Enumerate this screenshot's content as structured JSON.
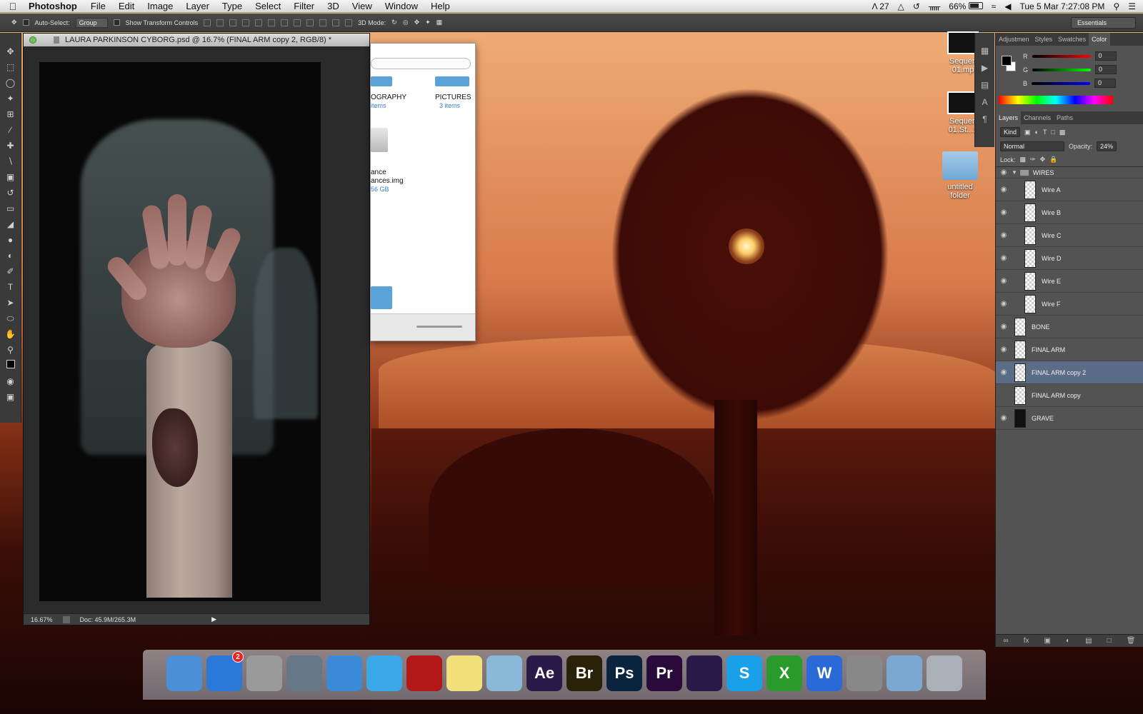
{
  "menubar": {
    "apple_icon": "apple-icon",
    "app_name": "Photoshop",
    "menus": [
      "File",
      "Edit",
      "Image",
      "Layer",
      "Type",
      "Select",
      "Filter",
      "3D",
      "View",
      "Window",
      "Help"
    ],
    "status": {
      "adobe_count": "27",
      "battery": "66%",
      "datetime": "Tue 5 Mar  7:27:08 PM"
    }
  },
  "options_bar": {
    "auto_select_label": "Auto-Select:",
    "auto_select_value": "Group",
    "transform_label": "Show Transform Controls",
    "mode_3d_label": "3D Mode:",
    "workspace": "Essentials"
  },
  "document": {
    "title": "LAURA PARKINSON CYBORG.psd @ 16.7% (FINAL ARM copy 2, RGB/8) *",
    "zoom": "16.67%",
    "doc_size": "Doc: 45.9M/265.3M"
  },
  "finder": {
    "col1_label": "OGRAPHY",
    "col1_sub": "items",
    "col2_label": "PICTURES",
    "col2_sub": "3 items",
    "file_name_line1": "ance",
    "file_name_line2": "ances.img",
    "file_size": "56 GB"
  },
  "desktop": {
    "items": [
      {
        "label": "Sequen 01.mp"
      },
      {
        "label": "Sequen 01.St...1"
      },
      {
        "label": "untitled folder"
      }
    ]
  },
  "color_panel": {
    "tabs": [
      "Adjustmen",
      "Styles",
      "Swatches",
      "Color"
    ],
    "active_tab": "Color",
    "r_label": "R",
    "r_value": "0",
    "g_label": "G",
    "g_value": "0",
    "b_label": "B",
    "b_value": "0"
  },
  "layers_panel": {
    "tabs": [
      "Layers",
      "Channels",
      "Paths"
    ],
    "active_tab": "Layers",
    "kind": "Kind",
    "blend_mode": "Normal",
    "opacity_label": "Opacity:",
    "opacity_value": "24%",
    "lock_label": "Lock:",
    "layers": [
      {
        "name": "WIRES",
        "type": "group",
        "visible": true
      },
      {
        "name": "Wire A",
        "type": "layer",
        "visible": true
      },
      {
        "name": "Wire B",
        "type": "layer",
        "visible": true
      },
      {
        "name": "Wire C",
        "type": "layer",
        "visible": true
      },
      {
        "name": "Wire D",
        "type": "layer",
        "visible": true
      },
      {
        "name": "Wire E",
        "type": "layer",
        "visible": true
      },
      {
        "name": "Wire F",
        "type": "layer",
        "visible": true
      },
      {
        "name": "BONE",
        "type": "layer",
        "visible": true
      },
      {
        "name": "FINAL ARM",
        "type": "layer",
        "visible": true
      },
      {
        "name": "FINAL ARM copy 2",
        "type": "layer",
        "visible": true,
        "selected": true
      },
      {
        "name": "FINAL ARM copy",
        "type": "layer",
        "visible": false
      },
      {
        "name": "GRAVE",
        "type": "layer",
        "visible": true
      }
    ]
  },
  "dock": {
    "apps": [
      {
        "name": "finder",
        "label": "",
        "color": "#4a8fd8"
      },
      {
        "name": "app-store",
        "label": "",
        "color": "#2a78d8",
        "badge": "2"
      },
      {
        "name": "launchpad",
        "label": "",
        "color": "#9a9a9a"
      },
      {
        "name": "iphoto",
        "label": "",
        "color": "#667788"
      },
      {
        "name": "safari",
        "label": "",
        "color": "#3a8ad8"
      },
      {
        "name": "itunes",
        "label": "",
        "color": "#3aa8e8"
      },
      {
        "name": "photo-booth",
        "label": "",
        "color": "#b21818"
      },
      {
        "name": "stickies",
        "label": "",
        "color": "#f2e07a"
      },
      {
        "name": "preview",
        "label": "",
        "color": "#8ab8d8"
      },
      {
        "name": "after-effects",
        "label": "Ae",
        "color": "#2a1a4a"
      },
      {
        "name": "bridge",
        "label": "Br",
        "color": "#2a2208"
      },
      {
        "name": "photoshop",
        "label": "Ps",
        "color": "#0a2440"
      },
      {
        "name": "premiere",
        "label": "Pr",
        "color": "#2a0a3a"
      },
      {
        "name": "media-encoder",
        "label": "",
        "color": "#2a1a4a"
      },
      {
        "name": "skype",
        "label": "S",
        "color": "#1aa0e8"
      },
      {
        "name": "excel",
        "label": "X",
        "color": "#2a9a2a"
      },
      {
        "name": "word",
        "label": "W",
        "color": "#2a6ad8"
      },
      {
        "name": "system-preferences",
        "label": "",
        "color": "#888888"
      },
      {
        "name": "downloads-folder",
        "label": "",
        "color": "#7aa8d0"
      },
      {
        "name": "trash",
        "label": "",
        "color": "#aab0b8"
      }
    ]
  }
}
